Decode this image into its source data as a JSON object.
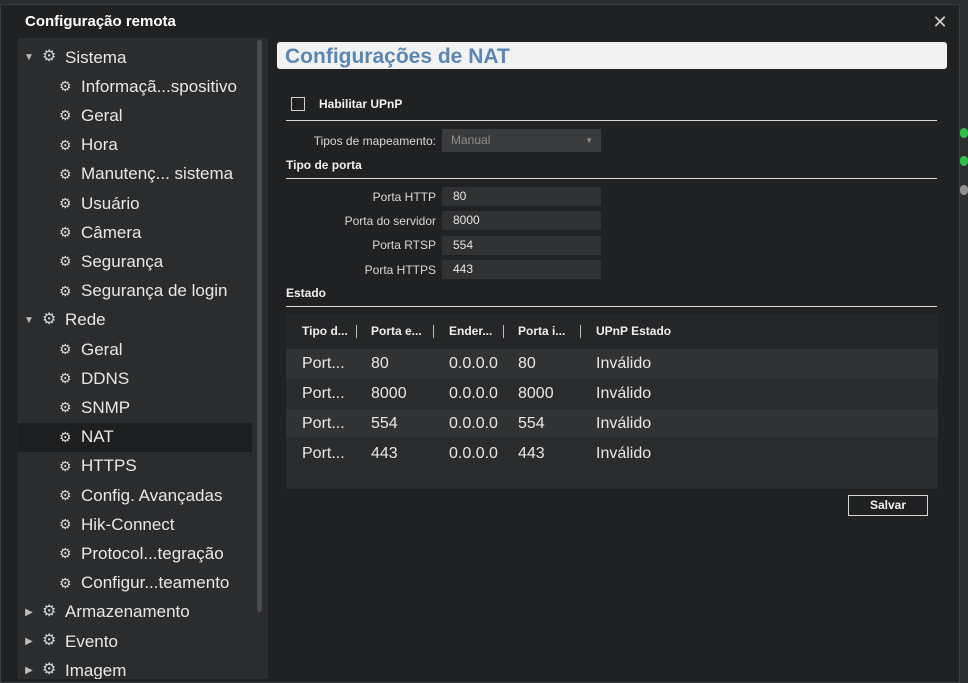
{
  "dialog": {
    "title": "Configuração remota"
  },
  "sidebar": {
    "items": [
      {
        "label": "Sistema",
        "level": 0,
        "expanded": true
      },
      {
        "label": "Informaçã...spositivo",
        "level": 1
      },
      {
        "label": "Geral",
        "level": 1
      },
      {
        "label": "Hora",
        "level": 1
      },
      {
        "label": "Manutenç... sistema",
        "level": 1
      },
      {
        "label": "Usuário",
        "level": 1
      },
      {
        "label": "Câmera",
        "level": 1
      },
      {
        "label": "Segurança",
        "level": 1
      },
      {
        "label": "Segurança de login",
        "level": 1
      },
      {
        "label": "Rede",
        "level": 0,
        "expanded": true
      },
      {
        "label": "Geral",
        "level": 1
      },
      {
        "label": "DDNS",
        "level": 1
      },
      {
        "label": "SNMP",
        "level": 1
      },
      {
        "label": "NAT",
        "level": 1,
        "selected": true
      },
      {
        "label": "HTTPS",
        "level": 1
      },
      {
        "label": "Config. Avançadas",
        "level": 1
      },
      {
        "label": "Hik-Connect",
        "level": 1
      },
      {
        "label": "Protocol...tegração",
        "level": 1
      },
      {
        "label": "Configur...teamento",
        "level": 1
      },
      {
        "label": "Armazenamento",
        "level": 0,
        "expanded": false
      },
      {
        "label": "Evento",
        "level": 0,
        "expanded": false
      },
      {
        "label": "Imagem",
        "level": 0,
        "expanded": false
      }
    ]
  },
  "main": {
    "header": "Configurações de NAT",
    "upnp_label": "Habilitar UPnP",
    "mapping_label": "Tipos de mapeamento:",
    "mapping_value": "Manual",
    "port_section": "Tipo de porta",
    "ports": [
      {
        "label": "Porta HTTP",
        "value": "80"
      },
      {
        "label": "Porta do servidor",
        "value": "8000"
      },
      {
        "label": "Porta RTSP",
        "value": "554"
      },
      {
        "label": "Porta HTTPS",
        "value": "443"
      }
    ],
    "state_section": "Estado",
    "table": {
      "headers": [
        "Tipo d...",
        "Porta e...",
        "Ender...",
        "Porta i...",
        "UPnP Estado"
      ],
      "rows": [
        [
          "Port...",
          "80",
          "0.0.0.0",
          "80",
          "Inválido"
        ],
        [
          "Port...",
          "8000",
          "0.0.0.0",
          "8000",
          "Inválido"
        ],
        [
          "Port...",
          "554",
          "0.0.0.0",
          "554",
          "Inválido"
        ],
        [
          "Port...",
          "443",
          "0.0.0.0",
          "443",
          "Inválido"
        ]
      ]
    },
    "save_label": "Salvar"
  },
  "colors": {
    "header_text": "#5b87b5",
    "background": "#202123",
    "sidebar": "#2b2c2e",
    "status_green": "#2fbf4a"
  }
}
